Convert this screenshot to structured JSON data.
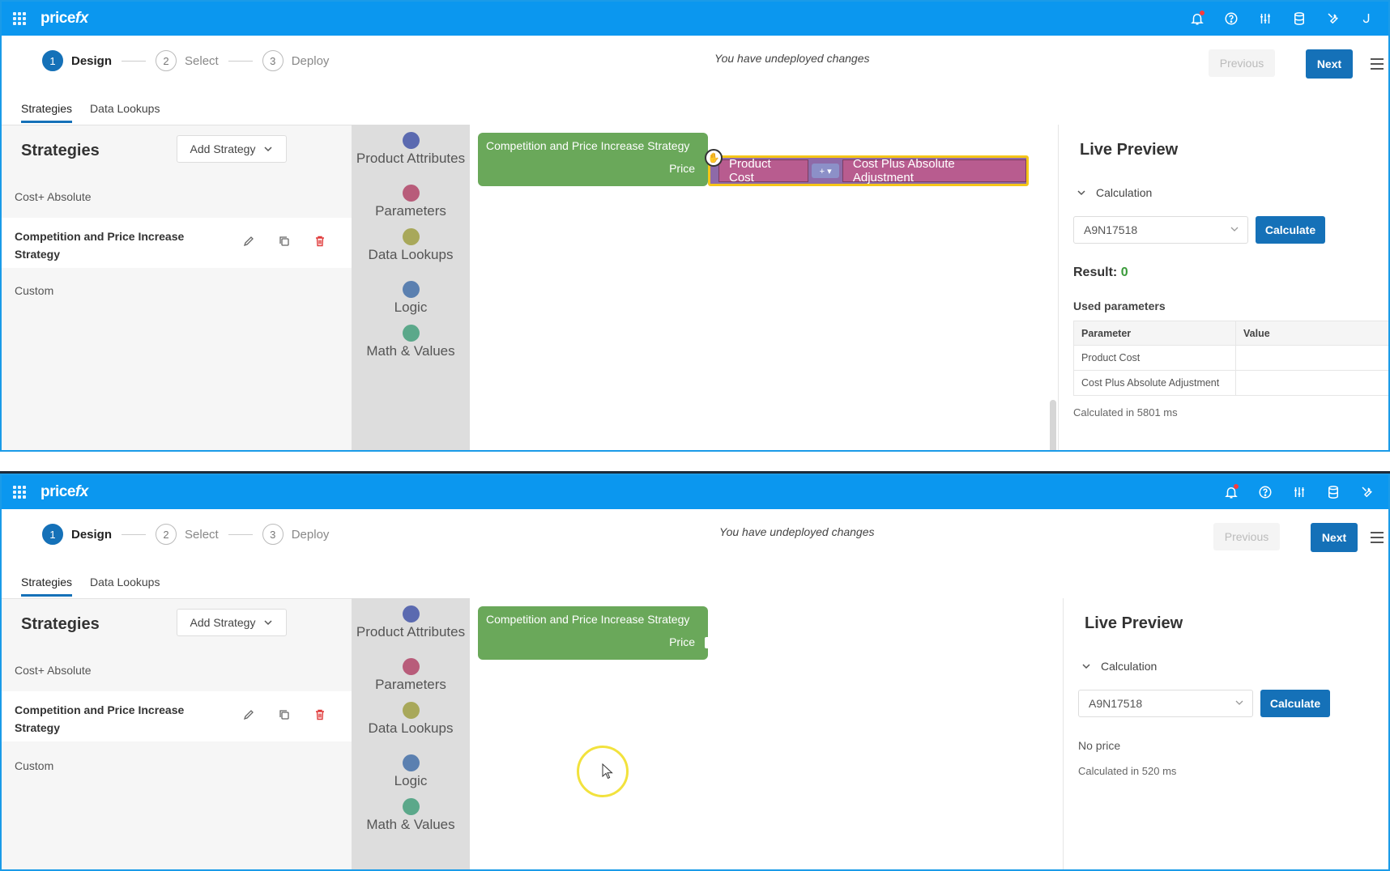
{
  "app": {
    "logo_text": "price",
    "logo_accent": "fx"
  },
  "stepper": {
    "steps": [
      {
        "num": "1",
        "label": "Design"
      },
      {
        "num": "2",
        "label": "Select"
      },
      {
        "num": "3",
        "label": "Deploy"
      }
    ],
    "status": "You have undeployed changes",
    "previous_label": "Previous",
    "next_label": "Next"
  },
  "tabs": [
    "Strategies",
    "Data Lookups"
  ],
  "strategies": {
    "title": "Strategies",
    "add_label": "Add Strategy",
    "items": [
      "Cost+ Absolute",
      "Competition and Price Increase Strategy",
      "Custom"
    ]
  },
  "palette": {
    "items": [
      {
        "label": "Product Attributes",
        "color": "#5b6ab0"
      },
      {
        "label": "Parameters",
        "color": "#b85c7a"
      },
      {
        "label": "Data Lookups",
        "color": "#a8a85a"
      },
      {
        "label": "Logic",
        "color": "#5b80b0"
      },
      {
        "label": "Math & Values",
        "color": "#5ba88a"
      }
    ]
  },
  "workspace": {
    "block_title": "Competition and Price Increase Strategy",
    "block_output": "Price",
    "expr_left": "Product Cost",
    "expr_op": "+ ▾",
    "expr_right": "Cost Plus Absolute Adjustment"
  },
  "preview": {
    "title": "Live Preview",
    "section": "Calculation",
    "product_id": "A9N17518",
    "calculate_label": "Calculate",
    "result_label": "Result:",
    "result_value": "0",
    "used_params_label": "Used parameters",
    "table_headers": [
      "Parameter",
      "Value"
    ],
    "table_rows": [
      [
        "Product Cost",
        ""
      ],
      [
        "Cost Plus Absolute Adjustment",
        ""
      ]
    ],
    "time_text_1": "Calculated in 5801 ms",
    "no_price_text": "No price",
    "time_text_2": "Calculated in 520 ms"
  },
  "colors": {
    "brand_blue": "#0b97ef",
    "primary_button": "#1571b8",
    "block_green": "#6aa85a",
    "delete_red": "#e03a3a"
  }
}
